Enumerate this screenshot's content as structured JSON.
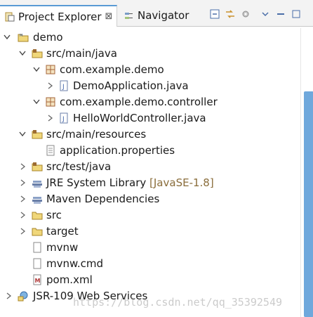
{
  "tabs": {
    "active": {
      "label": "Project Explorer",
      "close": "⊠"
    },
    "inactive": {
      "label": "Navigator"
    }
  },
  "tree": [
    {
      "label": "demo",
      "icon": "project-icon",
      "expanded": true
    },
    {
      "label": "src/main/java",
      "icon": "source-folder-icon",
      "expanded": true
    },
    {
      "label": "com.example.demo",
      "icon": "package-icon",
      "expanded": true
    },
    {
      "label": "DemoApplication.java",
      "icon": "java-file-icon",
      "expanded": false
    },
    {
      "label": "com.example.demo.controller",
      "icon": "package-icon",
      "expanded": true
    },
    {
      "label": "HelloWorldController.java",
      "icon": "java-file-icon",
      "expanded": false
    },
    {
      "label": "src/main/resources",
      "icon": "source-folder-icon",
      "expanded": true
    },
    {
      "label": "application.properties",
      "icon": "properties-file-icon"
    },
    {
      "label": "src/test/java",
      "icon": "source-folder-icon",
      "expanded": false
    },
    {
      "label": "JRE System Library",
      "decoration": "[JavaSE-1.8]",
      "icon": "library-icon",
      "expanded": false
    },
    {
      "label": "Maven Dependencies",
      "icon": "library-icon",
      "expanded": false
    },
    {
      "label": "src",
      "icon": "folder-icon",
      "expanded": false
    },
    {
      "label": "target",
      "icon": "folder-icon",
      "expanded": false
    },
    {
      "label": "mvnw",
      "icon": "file-icon"
    },
    {
      "label": "mvnw.cmd",
      "icon": "file-icon"
    },
    {
      "label": "pom.xml",
      "icon": "maven-pom-icon"
    },
    {
      "label": "JSR-109 Web Services",
      "icon": "web-services-icon",
      "expanded": false
    }
  ],
  "watermark": "https://blog.csdn.net/qq_35392549",
  "colors": {
    "accent": "#5a9bd5",
    "scrollbar": "#6fa8dc",
    "decoration": "#8a6d3b"
  }
}
